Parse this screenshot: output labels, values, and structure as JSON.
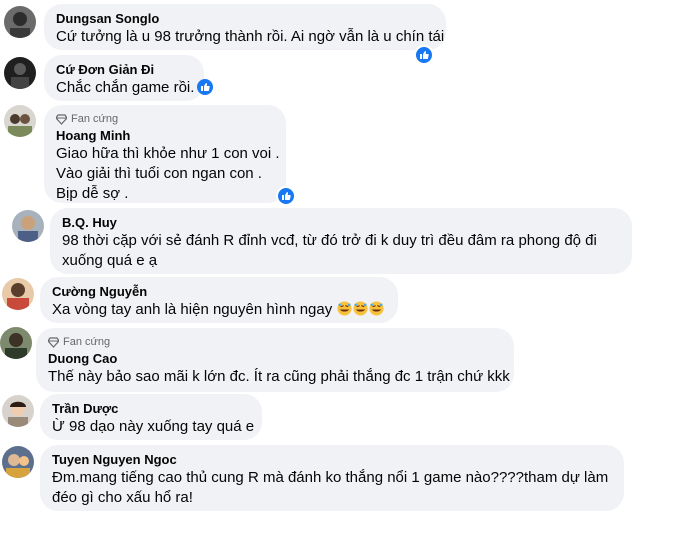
{
  "comments": [
    {
      "name": "Dungsan Songlo",
      "lines": [
        "Cứ tưởng là u 98 trưởng thành rồi. Ai ngờ vẫn là u chín tái"
      ]
    },
    {
      "name": "Cứ Đơn Giản Đi",
      "lines": [
        "Chắc chắn game rồi."
      ]
    },
    {
      "badge": "Fan cứng",
      "name": "Hoang Minh",
      "lines": [
        "Giao hữa thì khỏe như 1 con voi .",
        "Vào giải thì tuổi con ngan con .",
        "Bịp dễ sợ ."
      ]
    },
    {
      "name": "B.Q. Huy",
      "lines": [
        "98 thời cặp với sẻ đánh R đỉnh vcđ, từ đó trở đi k duy trì đều đâm ra phong độ đi",
        "xuống quá e ạ"
      ]
    },
    {
      "name": "Cường Nguyễn",
      "lines": [
        "Xa vòng tay anh là hiện nguyên hình ngay"
      ]
    },
    {
      "badge": "Fan cứng",
      "name": "Duong Cao",
      "lines": [
        "Thế này bảo sao mãi k lớn đc. Ít ra cũng phải thắng đc 1 trận chứ kkk"
      ]
    },
    {
      "name": "Trần Dược",
      "lines": [
        "Ừ 98 dạo này xuống tay quá e"
      ]
    },
    {
      "name": "Tuyen Nguyen Ngoc",
      "lines": [
        "Đm.mang tiếng cao thủ cung R mà đánh ko thắng nổi 1 game nào????tham dự làm",
        "đéo gì cho xấu hổ ra!"
      ]
    }
  ],
  "icons": {
    "reaction": "like-icon",
    "badge": "diamond-icon",
    "emoji": "rolling-on-floor-laughing-icon"
  },
  "colors": {
    "bubble": "#f0f2f5",
    "like": "#1877f2",
    "badge_text": "#65676b"
  }
}
